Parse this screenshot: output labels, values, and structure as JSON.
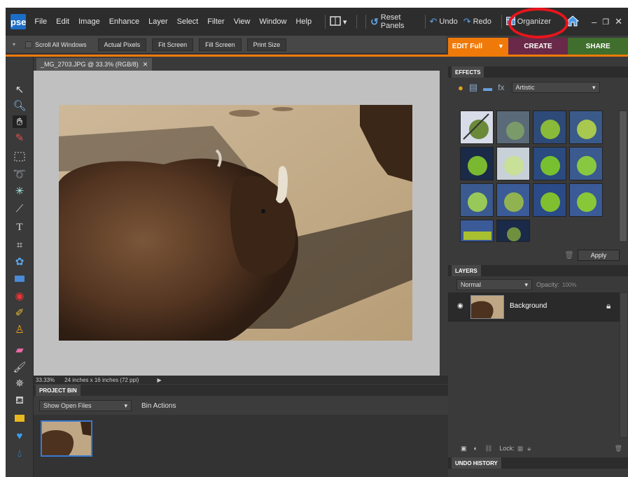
{
  "app": {
    "logo": "pse"
  },
  "menu": [
    "File",
    "Edit",
    "Image",
    "Enhance",
    "Layer",
    "Select",
    "Filter",
    "View",
    "Window",
    "Help"
  ],
  "toolbar": {
    "reset_panels": "Reset Panels",
    "undo": "Undo",
    "redo": "Redo",
    "organizer": "Organizer"
  },
  "options_bar": {
    "scroll_all_windows": "Scroll All Windows",
    "actual_pixels": "Actual Pixels",
    "fit_screen": "Fit Screen",
    "fill_screen": "Fill Screen",
    "print_size": "Print Size"
  },
  "mode_tabs": {
    "edit": "EDIT Full",
    "create": "CREATE",
    "share": "SHARE"
  },
  "document": {
    "tab_label": "_MG_2703.JPG @ 33.3% (RGB/8)",
    "zoom": "33.33%",
    "size_info": "24 inches x 16 inches (72 ppi)"
  },
  "project_bin": {
    "title": "PROJECT BIN",
    "show": "Show Open Files",
    "actions": "Bin Actions"
  },
  "effects": {
    "title": "EFFECTS",
    "category": "Artistic",
    "apply": "Apply"
  },
  "layers": {
    "title": "LAYERS",
    "blend_mode": "Normal",
    "opacity_label": "Opacity:",
    "opacity_value": "100%",
    "layer_name": "Background",
    "lock_label": "Lock:"
  },
  "undo_history": {
    "title": "UNDO HISTORY"
  },
  "colors": {
    "accent": "#f07a09",
    "create": "#6a2948",
    "share": "#3f6e2d",
    "highlight": "#e8151b"
  }
}
